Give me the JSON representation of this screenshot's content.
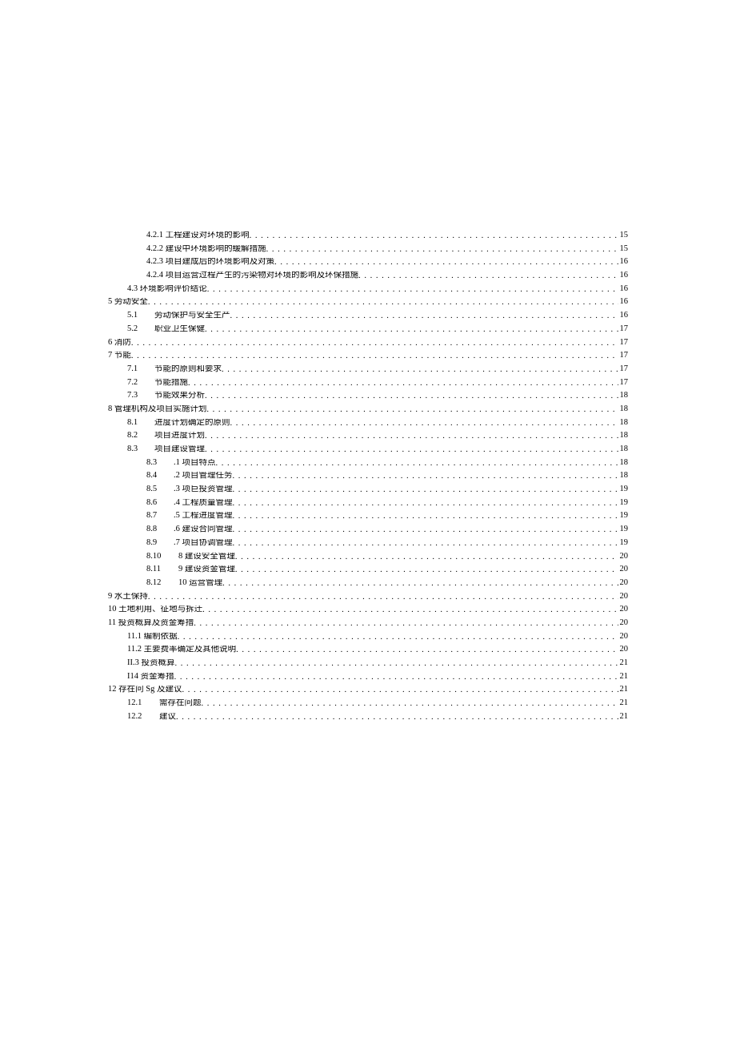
{
  "toc": [
    {
      "indent": "ind2",
      "num": "",
      "title": "4.2.1 工程建设对环境的影响",
      "page": "15"
    },
    {
      "indent": "ind2",
      "num": "",
      "title": "4.2.2 建设中环境影响的缓解措施",
      "page": "15"
    },
    {
      "indent": "ind2",
      "num": "",
      "title": "4.2.3 项目建成后的环境影响及对策",
      "page": "16"
    },
    {
      "indent": "ind2",
      "num": "",
      "title": "4.2.4 项目运营过程产生的污染物对环境的影响及环保措施",
      "page": "16"
    },
    {
      "indent": "ind1b",
      "num": "",
      "title": "4.3 环境影响评价结论",
      "page": "16"
    },
    {
      "indent": "ind0",
      "num": "",
      "title": "5 劳动安全",
      "page": "16"
    },
    {
      "indent": "ind1",
      "num": "5.1",
      "title": "劳动保护与安全生产",
      "page": "16"
    },
    {
      "indent": "ind1",
      "num": "5.2",
      "title": "职业卫生保健",
      "page": "17"
    },
    {
      "indent": "ind0",
      "num": "",
      "title": "6 消防",
      "page": "17"
    },
    {
      "indent": "ind0",
      "num": "",
      "title": "7 节能",
      "page": "17"
    },
    {
      "indent": "ind1",
      "num": "7.1",
      "title": "节能的原则和要求",
      "page": "17"
    },
    {
      "indent": "ind1",
      "num": "7.2",
      "title": "节能措施",
      "page": "17"
    },
    {
      "indent": "ind1",
      "num": "7.3",
      "title": "节能效果分析",
      "page": "18"
    },
    {
      "indent": "ind0",
      "num": "",
      "title": "8 管理机构及项目实施计划",
      "page": "18"
    },
    {
      "indent": "ind1",
      "num": "8.1",
      "title": "进度计划确定的原则",
      "page": "18"
    },
    {
      "indent": "ind1",
      "num": "8.2",
      "title": "项目进度计划",
      "page": "18"
    },
    {
      "indent": "ind1",
      "num": "8.3",
      "title": "项目建设管理",
      "page": "18"
    },
    {
      "indent": "ind3",
      "num": "8.3",
      "title": ".1 项目特点",
      "page": "18"
    },
    {
      "indent": "ind3",
      "num": "8.4",
      "title": ".2 项目管理任务",
      "page": "18"
    },
    {
      "indent": "ind3",
      "num": "8.5",
      "title": ".3 项巨投资管理",
      "page": "19"
    },
    {
      "indent": "ind3",
      "num": "8.6",
      "title": ".4 工程质量管理",
      "page": "19"
    },
    {
      "indent": "ind3",
      "num": "8.7",
      "title": ".5 工程进度管理",
      "page": "19"
    },
    {
      "indent": "ind3",
      "num": "8.8",
      "title": ".6 建设合同管理",
      "page": "19"
    },
    {
      "indent": "ind3",
      "num": "8.9",
      "title": ".7 项目协调管理",
      "page": "19"
    },
    {
      "indent": "ind3",
      "num": "8.10",
      "title": "8 建设安全管理",
      "page": "20"
    },
    {
      "indent": "ind3",
      "num": "8.11",
      "title": "9 建设资金管理",
      "page": "20"
    },
    {
      "indent": "ind3",
      "num": "8.12",
      "title": "10 运营管理",
      "page": "20"
    },
    {
      "indent": "ind0",
      "num": "",
      "title": "9 水土保持",
      "page": "20"
    },
    {
      "indent": "ind0",
      "num": "",
      "title": "10 土地利用、征地与拆迁",
      "page": "20"
    },
    {
      "indent": "ind0",
      "num": "",
      "title": "11 投资概算及资金筹措",
      "page": "20"
    },
    {
      "indent": "ind1b",
      "num": "",
      "title": "11.1 编制依据",
      "page": "20"
    },
    {
      "indent": "ind1b",
      "num": "",
      "title": "11.2 主要费率确定及其他说明",
      "page": "20"
    },
    {
      "indent": "ind1b",
      "num": "",
      "title": "II.3 投资概算",
      "page": "21"
    },
    {
      "indent": "ind1b",
      "num": "",
      "title": "I14 资金筹措",
      "page": "21"
    },
    {
      "indent": "ind0",
      "num": "",
      "title": "12 存在问 Sg 及建议",
      "page": "21"
    },
    {
      "indent": "ind1",
      "num": "12.1",
      "title": "需存在问题",
      "page": "21"
    },
    {
      "indent": "ind1",
      "num": "12.2",
      "title": "建议",
      "page": "21"
    }
  ]
}
